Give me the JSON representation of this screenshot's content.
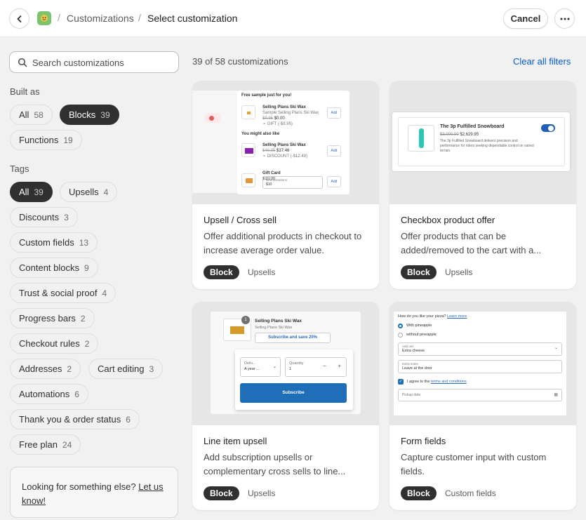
{
  "header": {
    "breadcrumb_parent": "Customizations",
    "breadcrumb_current": "Select customization",
    "cancel_label": "Cancel"
  },
  "search": {
    "placeholder": "Search customizations"
  },
  "built_as": {
    "label": "Built as",
    "items": [
      {
        "label": "All",
        "count": "58",
        "active": false
      },
      {
        "label": "Blocks",
        "count": "39",
        "active": true
      },
      {
        "label": "Functions",
        "count": "19",
        "active": false
      }
    ]
  },
  "tags": {
    "label": "Tags",
    "items": [
      {
        "label": "All",
        "count": "39",
        "active": true
      },
      {
        "label": "Upsells",
        "count": "4",
        "active": false
      },
      {
        "label": "Discounts",
        "count": "3",
        "active": false
      },
      {
        "label": "Custom fields",
        "count": "13",
        "active": false
      },
      {
        "label": "Content blocks",
        "count": "9",
        "active": false
      },
      {
        "label": "Trust & social proof",
        "count": "4",
        "active": false
      },
      {
        "label": "Progress bars",
        "count": "2",
        "active": false
      },
      {
        "label": "Checkout rules",
        "count": "2",
        "active": false
      },
      {
        "label": "Addresses",
        "count": "2",
        "active": false
      },
      {
        "label": "Cart editing",
        "count": "3",
        "active": false
      },
      {
        "label": "Automations",
        "count": "6",
        "active": false
      },
      {
        "label": "Thank you & order status",
        "count": "6",
        "active": false
      },
      {
        "label": "Free plan",
        "count": "24",
        "active": false
      }
    ]
  },
  "feedback": {
    "text": "Looking for something else?",
    "link": "Let us know!"
  },
  "results": {
    "count_text": "39 of 58 customizations",
    "clear_label": "Clear all filters"
  },
  "cards": [
    {
      "title": "Upsell / Cross sell",
      "description": "Offer additional products in checkout to increase average order value.",
      "badge": "Block",
      "tag": "Upsells"
    },
    {
      "title": "Checkbox product offer",
      "description": "Offer products that can be added/removed to the cart with a...",
      "badge": "Block",
      "tag": "Upsells"
    },
    {
      "title": "Line item upsell",
      "description": "Add subscription upsells or complementary cross sells to line...",
      "badge": "Block",
      "tag": "Upsells"
    },
    {
      "title": "Form fields",
      "description": "Capture customer input with custom fields.",
      "badge": "Block",
      "tag": "Custom fields"
    }
  ],
  "previews": {
    "upsell": {
      "heading": "Free sample just for you!",
      "product1_name": "Selling Plans Ski Wax",
      "product1_sub": "Sample Selling Plans Ski Wax",
      "product1_old": "$9.95",
      "product1_price": "$0.00",
      "product1_gift": "GIFT (-$9.95)",
      "add": "Add",
      "also_like": "You might also like",
      "product2_name": "Selling Plans Ski Wax",
      "product2_old": "$49.95",
      "product2_price": "$37.46",
      "product2_discount": "DISCOUNT (-$12.49)",
      "product3_name": "Gift Card",
      "product3_price": "$10.00",
      "denom_label": "Denominations",
      "denom_value": "$10"
    },
    "checkbox": {
      "name": "The 3p Fulfilled Snowboard",
      "old_price": "$3,000.00",
      "price": "$2,629.95",
      "desc": "The 3p Fulfilled Snowboard delivers precision and performance for riders seeking dependable control on varied terrain."
    },
    "line_item": {
      "qty_badge": "1",
      "name": "Selling Plans Ski Wax",
      "sub": "Selling Plans Ski Wax",
      "subscribe_link": "Subscribe and save 20%",
      "delivery_label": "Deliv...",
      "delivery_value": "A year ...",
      "quantity_label": "Quantity",
      "quantity_value": "1",
      "subscribe_btn": "Subscribe"
    },
    "form": {
      "question": "How do you like your pizza?",
      "learn_more": "Learn more",
      "option1": "With pineapple",
      "option2": "without pineapple",
      "addon_label": "Add ons",
      "addon_value": "Extra cheese",
      "notes_label": "Extra notes",
      "notes_value": "Leave at the door",
      "agree_text": "I agree to the",
      "terms_link": "terms and conditions",
      "pickup": "Pickup date"
    }
  }
}
